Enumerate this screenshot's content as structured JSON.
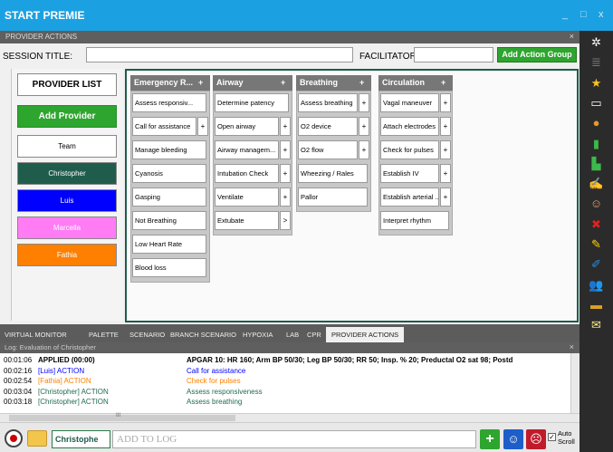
{
  "app": {
    "title": "START PREMIE",
    "minimize": "_",
    "maximize": "□",
    "close": "x"
  },
  "panel": {
    "title": "PROVIDER ACTIONS",
    "close": "×"
  },
  "session": {
    "title_label": "SESSION TITLE:",
    "title_value": "",
    "facilitator_label": "FACILITATOR:",
    "facilitator_value": "",
    "add_group_label": "Add Action Group"
  },
  "providers": {
    "list_label": "PROVIDER LIST",
    "add_label": "Add Provider",
    "items": [
      {
        "name": "Team",
        "color": "#ffffff",
        "text_color": "#000000"
      },
      {
        "name": "Christopher",
        "color": "#1f5c4c",
        "text_color": "#ffffff"
      },
      {
        "name": "Luis",
        "color": "#0000ff",
        "text_color": "#ffffff"
      },
      {
        "name": "Marcella",
        "color": "#ff7cf5",
        "text_color": "#ffffff"
      },
      {
        "name": "Fathia",
        "color": "#ff8000",
        "text_color": "#ffffff"
      }
    ]
  },
  "columns": [
    {
      "title": "Emergency R...",
      "plus": "+",
      "actions": [
        {
          "label": "Assess responsiv...",
          "has_plus": false
        },
        {
          "label": "Call for assistance",
          "has_plus": true
        },
        {
          "label": "Manage bleeding",
          "has_plus": false
        },
        {
          "label": "Cyanosis",
          "has_plus": false
        },
        {
          "label": "Gasping",
          "has_plus": false
        },
        {
          "label": "Not Breathing",
          "has_plus": false
        },
        {
          "label": "Low Heart Rate",
          "has_plus": false
        },
        {
          "label": "Blood loss",
          "has_plus": false
        }
      ]
    },
    {
      "title": "Airway",
      "plus": "+",
      "actions": [
        {
          "label": "Determine patency",
          "has_plus": false
        },
        {
          "label": "Open airway",
          "has_plus": true
        },
        {
          "label": "Airway managem...",
          "has_plus": true
        },
        {
          "label": "Intubation Check",
          "has_plus": true
        },
        {
          "label": "Ventilate",
          "has_plus": true
        },
        {
          "label": "Extubate",
          "has_plus": true,
          "plus": ">"
        }
      ]
    },
    {
      "title": "Breathing",
      "plus": "+",
      "actions": [
        {
          "label": "Assess breathing",
          "has_plus": true
        },
        {
          "label": "O2 device",
          "has_plus": true
        },
        {
          "label": "O2 flow",
          "has_plus": true
        },
        {
          "label": "Wheezing / Rales",
          "has_plus": false
        },
        {
          "label": "Pallor",
          "has_plus": false
        }
      ]
    },
    {
      "title": "Circulation",
      "plus": "+",
      "actions": [
        {
          "label": "Vagal maneuver",
          "has_plus": true
        },
        {
          "label": "Attach electrodes",
          "has_plus": true
        },
        {
          "label": "Check for pulses",
          "has_plus": true
        },
        {
          "label": "Establish IV",
          "has_plus": true
        },
        {
          "label": "Establish arterial ...",
          "has_plus": true
        },
        {
          "label": "Interpret rhythm",
          "has_plus": false
        }
      ]
    }
  ],
  "tabs": [
    "VIRTUAL MONITOR",
    "PALETTE",
    "SCENARIO",
    "BRANCH SCENARIO",
    "HYPOXIA",
    "LAB",
    "CPR",
    "PROVIDER ACTIONS"
  ],
  "active_tab": "PROVIDER ACTIONS",
  "log": {
    "title": "Log: Evaluation of Christopher",
    "close": "×",
    "rows": [
      {
        "time": "00:01:06",
        "actor": "APPLIED (00:00)",
        "event": "APGAR 10: HR 160; Arm BP 50/30; Leg BP 50/30; RR 50; Insp. % 20; Preductal O2 sat 98; Postd",
        "actor_color": "#000000",
        "event_color": "#000000",
        "bold": true
      },
      {
        "time": "00:02:16",
        "actor": "[Luis] ACTION",
        "event": "Call for assistance",
        "actor_color": "#0000ff",
        "event_color": "#0000ff",
        "bold": false
      },
      {
        "time": "00:02:54",
        "actor": "[Fathia] ACTION",
        "event": "Check for pulses",
        "actor_color": "#ff8000",
        "event_color": "#ff8000",
        "bold": false
      },
      {
        "time": "00:03:04",
        "actor": "[Christopher] ACTION",
        "event": "Assess responsiveness",
        "actor_color": "#1f6b4f",
        "event_color": "#1f6b4f",
        "bold": false
      },
      {
        "time": "00:03:18",
        "actor": "[Christopher] ACTION",
        "event": "Assess breathing",
        "actor_color": "#1f6b4f",
        "event_color": "#1f6b4f",
        "bold": false
      }
    ],
    "hscroll_mark": "III"
  },
  "bottom": {
    "provider_value": "Christophe",
    "add_to_log_placeholder": "ADD TO LOG",
    "auto_scroll_label": "Auto Scroll",
    "auto_scroll_checked": "✓"
  },
  "right_bar_icons": [
    "gear-icon",
    "list-icon",
    "star-icon",
    "monitor-icon",
    "soccer-ball-icon",
    "equipment-icon",
    "network-icon",
    "signature-icon",
    "baby-icon",
    "x-icon",
    "pencil-icon",
    "syringe-icon",
    "people-icon",
    "id-card-icon",
    "note-icon"
  ]
}
